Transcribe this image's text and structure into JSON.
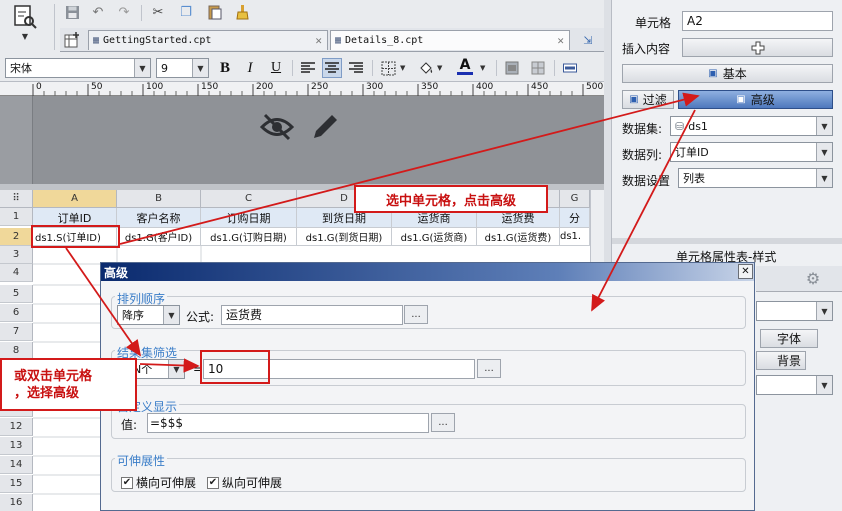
{
  "toolbar": {
    "font_name": "宋体",
    "font_size": "9",
    "bold": "B",
    "italic": "I",
    "underline": "U"
  },
  "tabs": [
    {
      "label": "GettingStarted.cpt"
    },
    {
      "label": "Details_8.cpt"
    }
  ],
  "ruler": {
    "ticks": [
      "0",
      "50",
      "100",
      "150",
      "200",
      "250",
      "300",
      "350",
      "400",
      "450",
      "500",
      "550"
    ]
  },
  "sheet": {
    "corner": "⠿",
    "columns": [
      "A",
      "B",
      "C",
      "D",
      "E",
      "F",
      "G"
    ],
    "rows": [
      "1",
      "2",
      "3",
      "4",
      "5",
      "6",
      "7",
      "8",
      "9",
      "10",
      "11",
      "12",
      "13",
      "14",
      "15",
      "16"
    ],
    "header_row": [
      "订单ID",
      "客户名称",
      "订购日期",
      "到货日期",
      "运货商",
      "运货费",
      "分"
    ],
    "data_row": [
      "ds1.S(订单ID)",
      "ds1.G(客户ID)",
      "ds1.G(订购日期)",
      "ds1.G(到货日期)",
      "ds1.G(运货商)",
      "ds1.G(运货费)",
      "ds1."
    ]
  },
  "right_panel": {
    "cell_label": "单元格",
    "cell_value": "A2",
    "insert_label": "插入内容",
    "basic_button": "基本",
    "filter_button": "过滤",
    "advanced_button": "高级",
    "dataset_label": "数据集:",
    "dataset_value": "ds1",
    "column_label": "数据列:",
    "column_value": "订单ID",
    "setting_label": "数据设置",
    "setting_value": "列表",
    "style_title": "单元格属性表-样式",
    "font_button": "字体",
    "background_label": "背景"
  },
  "dialog": {
    "title": "高级",
    "close": "✕",
    "sort_section": "排列顺序",
    "sort_value": "降序",
    "formula_label": "公式:",
    "formula_value": "运货费",
    "filter_section": "结果集筛选",
    "filter_mode": "前N个",
    "equals": "=",
    "filter_value": "10",
    "custom_section": "自定义显示",
    "value_label": "值:",
    "custom_value": "=$$$",
    "expand_section": "可伸展性",
    "horizontal_expand": "横向可伸展",
    "vertical_expand": "纵向可伸展",
    "ellipsis": "..."
  },
  "callouts": {
    "top": "选中单元格，点击高级",
    "left_line1": "或双击单元格",
    "left_line2": "，选择高级"
  },
  "colors": {
    "accent_red": "#d31a1a",
    "dialog_title": "#0a2a6e",
    "selected_button": "#5f86c4",
    "section_blue": "#3a7dc8"
  }
}
